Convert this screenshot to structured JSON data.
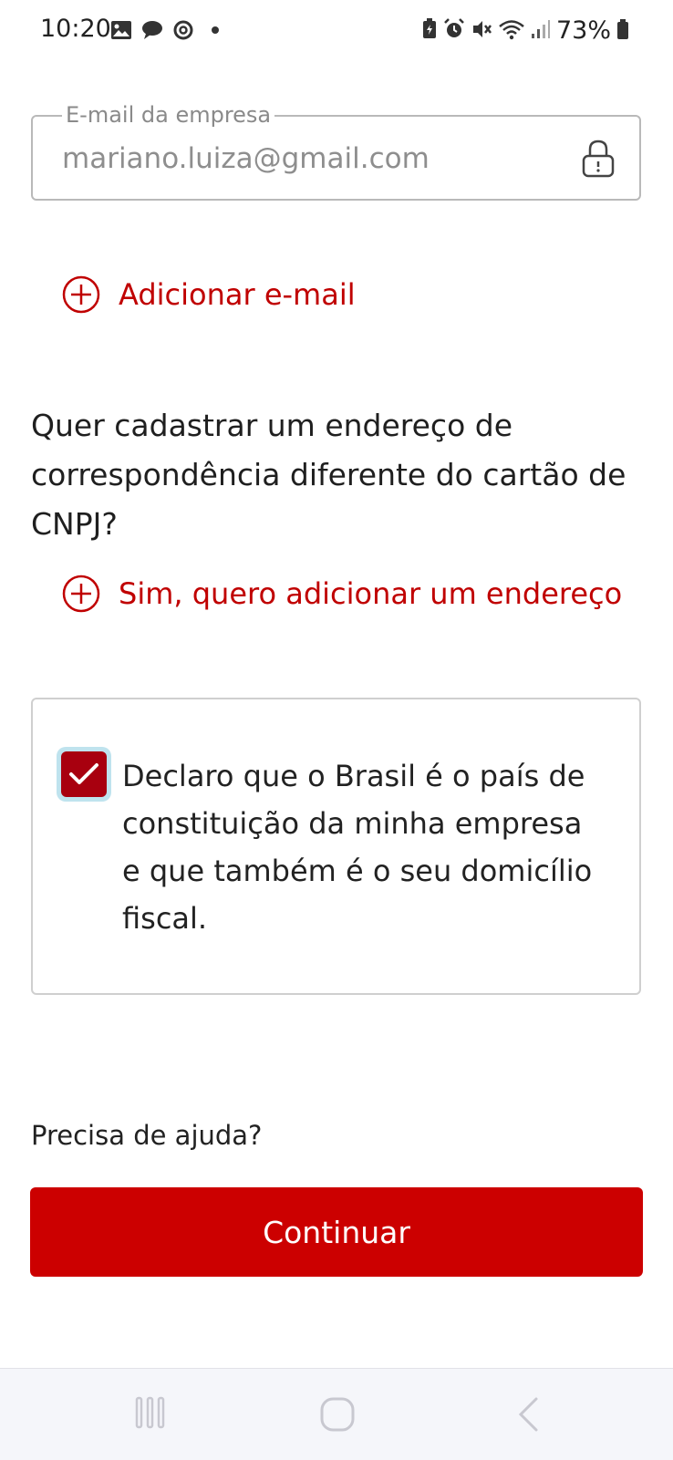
{
  "status_bar": {
    "time": "10:20",
    "battery": "73%",
    "icons_left": [
      "gallery-icon",
      "chat-icon",
      "threads-icon",
      "dot-icon"
    ],
    "icons_right": [
      "battery-saver-icon",
      "alarm-icon",
      "mute-icon",
      "wifi-icon",
      "signal-icon",
      "battery-icon"
    ]
  },
  "email_field": {
    "label": "E-mail da empresa",
    "value": "mariano.luiza@gmail.com",
    "icon": "lock-icon"
  },
  "add_email": {
    "label": "Adicionar e-mail",
    "icon": "plus-circle-icon"
  },
  "address_question": "Quer cadastrar um endereço de correspondência diferente do cartão de CNPJ?",
  "add_address": {
    "label": "Sim, quero adicionar um endereço",
    "icon": "plus-circle-icon"
  },
  "declaration": {
    "checked": true,
    "text": "Declaro que o Brasil é o país de constituição da minha empresa e que também é o seu domicílio fiscal."
  },
  "help_text": "Precisa de ajuda?",
  "continue_button": "Continuar",
  "colors": {
    "accent": "#cc0000",
    "checkbox": "#a8000f",
    "checkbox_focus": "#bfe3ee"
  },
  "nav_bar": [
    "recent-apps-icon",
    "home-icon",
    "back-icon"
  ]
}
